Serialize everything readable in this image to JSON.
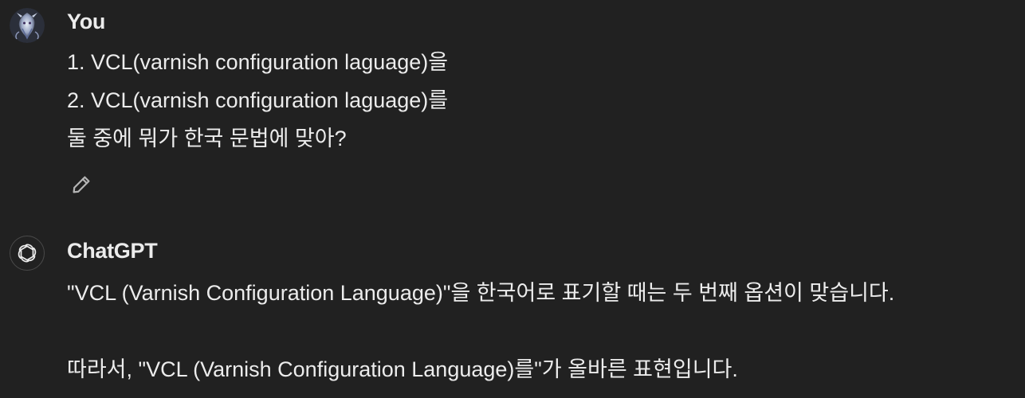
{
  "user_message": {
    "author": "You",
    "avatar_icon": "dragon-avatar-icon",
    "lines": [
      "1. VCL(varnish configuration laguage)을",
      "2. VCL(varnish configuration laguage)를",
      "둘 중에 뭐가 한국 문법에 맞아?"
    ],
    "edit_icon": "pencil-icon"
  },
  "assistant_message": {
    "author": "ChatGPT",
    "avatar_icon": "openai-logo-icon",
    "lines": [
      "\"VCL (Varnish Configuration Language)\"을 한국어로 표기할 때는 두 번째 옵션이 맞습니다.",
      "따라서, \"VCL (Varnish Configuration Language)를\"가 올바른 표현입니다."
    ]
  },
  "colors": {
    "background": "#212121",
    "text": "#ececec",
    "icon": "#b4b4b4"
  }
}
